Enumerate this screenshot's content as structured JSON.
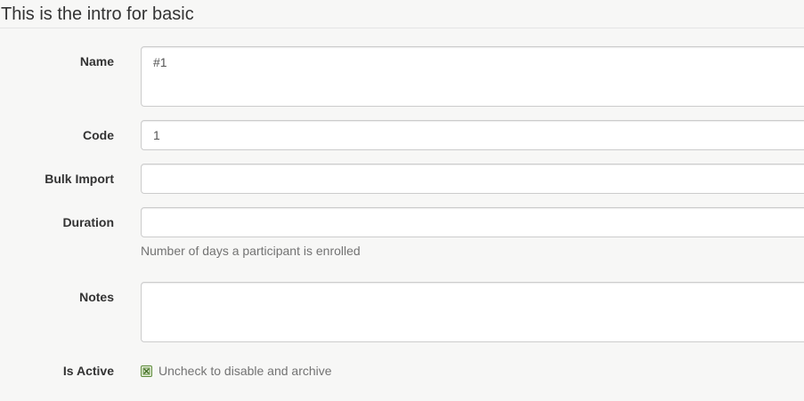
{
  "intro": {
    "text": "This is the intro for basic"
  },
  "form": {
    "name": {
      "label": "Name",
      "value": "#1"
    },
    "code": {
      "label": "Code",
      "value": "1"
    },
    "bulk_import": {
      "label": "Bulk Import",
      "value": ""
    },
    "duration": {
      "label": "Duration",
      "value": "",
      "help": "Number of days a participant is enrolled"
    },
    "notes": {
      "label": "Notes",
      "value": ""
    },
    "is_active": {
      "label": "Is Active",
      "checked": true,
      "help": "Uncheck to disable and archive",
      "icon": "checkbox-checked-icon",
      "color": "#5c8a3a"
    }
  }
}
